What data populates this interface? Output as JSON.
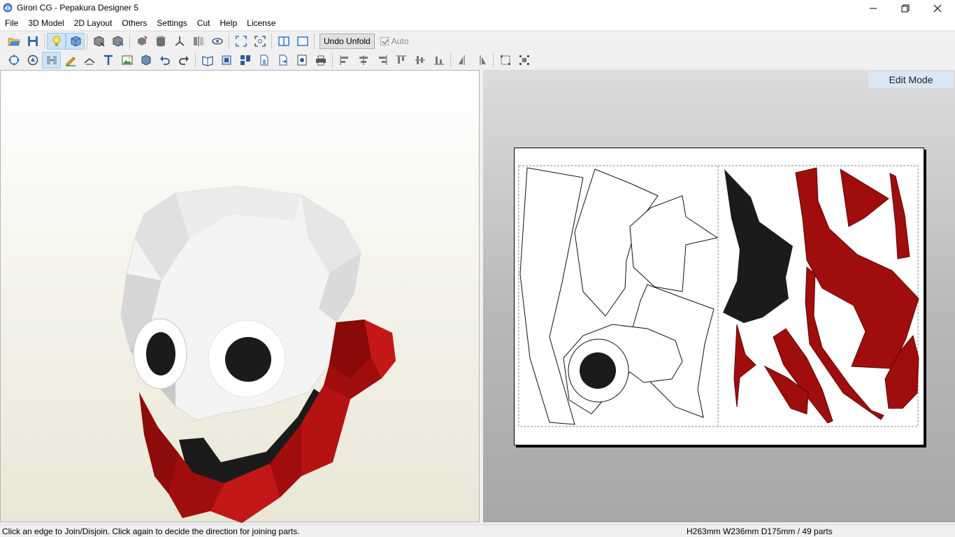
{
  "window": {
    "title": "Girori CG - Pepakura Designer 5",
    "icon": "pepakura-app-icon",
    "controls": [
      "minimize-icon",
      "restore-icon",
      "close-icon"
    ]
  },
  "menu": [
    "File",
    "3D Model",
    "2D Layout",
    "Others",
    "Settings",
    "Cut",
    "Help",
    "License"
  ],
  "toolbar1": {
    "undo_unfold_label": "Undo Unfold",
    "auto_label": "Auto",
    "auto_checked": true,
    "icons": [
      "open-icon",
      "save-icon",
      "light-icon",
      "texture-icon",
      "unfold-icon",
      "unfold-selected-icon",
      "move-parts-icon",
      "cylinder-icon",
      "axis-icon",
      "fold-lines-icon",
      "show-hide-icon",
      "fit-3d-icon",
      "fit-2d-icon",
      "split-view-icon",
      "single-view-icon"
    ]
  },
  "toolbar2": {
    "icons": [
      "rotate-icon",
      "rotate-part-icon",
      "join-edge-icon",
      "pencil-icon",
      "fold-icon",
      "text-icon",
      "image-icon",
      "box-icon",
      "undo-icon",
      "redo-icon",
      "book-icon",
      "fit-page-icon",
      "arrange-icon",
      "page-number-icon",
      "export-icon",
      "print-preview-icon",
      "print-icon",
      "align-left-icon",
      "align-center-icon",
      "align-right-icon",
      "align-top-icon",
      "align-middle-icon",
      "align-bottom-icon",
      "flip-left-icon",
      "flip-right-icon",
      "select-icon",
      "group-icon"
    ]
  },
  "view2d": {
    "mode_label": "Edit Mode"
  },
  "colors": {
    "mask_white": "#ffffff",
    "mask_red": "#a00d0d",
    "mask_black": "#1b1b1b",
    "edit_mode_bg": "#d9e7f5"
  },
  "status": {
    "hint": "Click an edge to Join/Disjoin. Click again to decide the direction for joining parts.",
    "dimensions": "H263mm W236mm D175mm / 49 parts"
  }
}
